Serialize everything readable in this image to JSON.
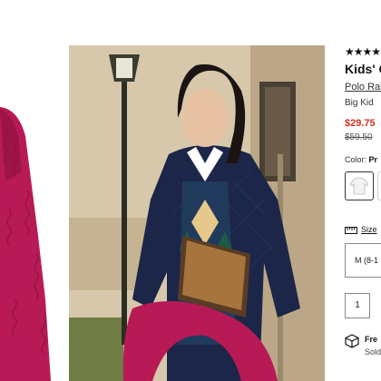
{
  "product": {
    "rating_stars": "★★★★★",
    "title": "Kids' C",
    "brand": "Polo Ral",
    "size_group": "Big Kid",
    "sale_price": "$29.75",
    "original_price": "$59.50",
    "color_label": "Color:",
    "color_value": "Pr"
  },
  "size_guide": {
    "label": "Size",
    "selected": "M (8-1"
  },
  "quantity": "1",
  "shipping": {
    "title": "Fre",
    "subtitle": "Sold"
  },
  "colors": {
    "sale": "#d62d20",
    "sweater": "#b81a55",
    "jacket": "#1c2648"
  }
}
